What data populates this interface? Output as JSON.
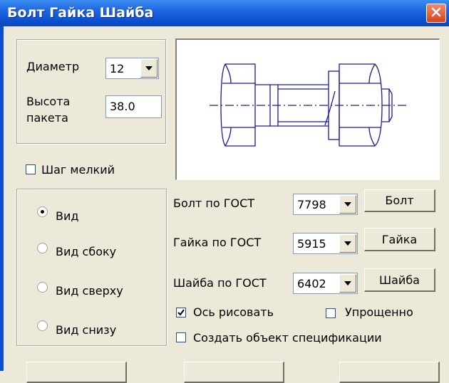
{
  "window": {
    "title": "Болт Гайка Шайба"
  },
  "params": {
    "diameter_label": "Диаметр",
    "diameter_value": "12",
    "height_label_line1": "Высота",
    "height_label_line2": "пакета",
    "height_value": "38.0"
  },
  "fine_pitch": {
    "label": "Шаг мелкий",
    "checked": false
  },
  "views": [
    {
      "label": "Вид",
      "selected": true
    },
    {
      "label": "Вид сбоку",
      "selected": false
    },
    {
      "label": "Вид сверху",
      "selected": false
    },
    {
      "label": "Вид снизу",
      "selected": false
    }
  ],
  "gost": {
    "bolt_label": "Болт по ГОСТ",
    "bolt_value": "7798",
    "bolt_button": "Болт",
    "nut_label": "Гайка по ГОСТ",
    "nut_value": "5915",
    "nut_button": "Гайка",
    "washer_label": "Шайба по ГОСТ",
    "washer_value": "6402",
    "washer_button": "Шайба"
  },
  "options": {
    "draw_axis": {
      "label": "Ось рисовать",
      "checked": true
    },
    "simplified": {
      "label": "Упрощенно",
      "checked": false
    },
    "create_spec": {
      "label": "Создать объект спецификации",
      "checked": false
    }
  },
  "colors": {
    "drawing_line": "#1a1a9a",
    "title_bar": "#0a4fd0"
  },
  "icons": {
    "close": "close-icon",
    "dropdown": "chevron-down-icon",
    "check": "checkmark-icon"
  }
}
